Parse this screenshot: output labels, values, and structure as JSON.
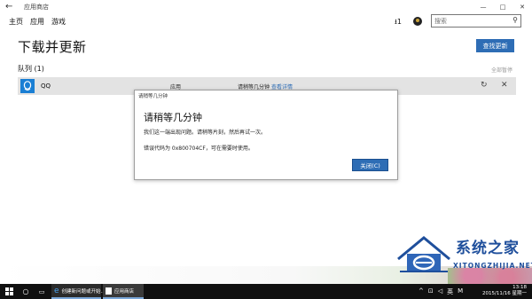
{
  "window": {
    "title": "应用商店",
    "back_icon": "back-arrow-icon",
    "minimize": "—",
    "maximize": "□",
    "close": "✕"
  },
  "nav": {
    "home": "主页",
    "apps": "应用",
    "games": "游戏",
    "download_count": "1",
    "search_placeholder": "搜索"
  },
  "page": {
    "title": "下载并更新",
    "check_updates": "查找更新",
    "queue_heading": "队列 (1)",
    "pause_all": "全部暂停"
  },
  "queue": [
    {
      "name": "QQ",
      "category": "应用",
      "status": "请稍等几分钟",
      "details_link": "查看详情"
    }
  ],
  "dialog": {
    "caption": "请稍等几分钟",
    "heading": "请稍等几分钟",
    "message": "我们这一端出现问题。请稍等片刻，然后再试一次。",
    "error": "错误代码为 0x800704CF，可在需要时使用。",
    "close_button": "关闭(C)"
  },
  "watermark": {
    "brand": "系统之家",
    "url": "XITONGZHIJIA.NET"
  },
  "taskbar": {
    "app1": "创建新问题或开始...",
    "app2": "应用商店",
    "time": "13:18",
    "date": "2015/11/16 星期一",
    "lang": "英",
    "tray_m": "M"
  },
  "colors": {
    "accent": "#2e6db5",
    "row_bg": "#e3e3e3",
    "taskbar": "#101010",
    "watermark_blue": "#1f4f9c"
  }
}
